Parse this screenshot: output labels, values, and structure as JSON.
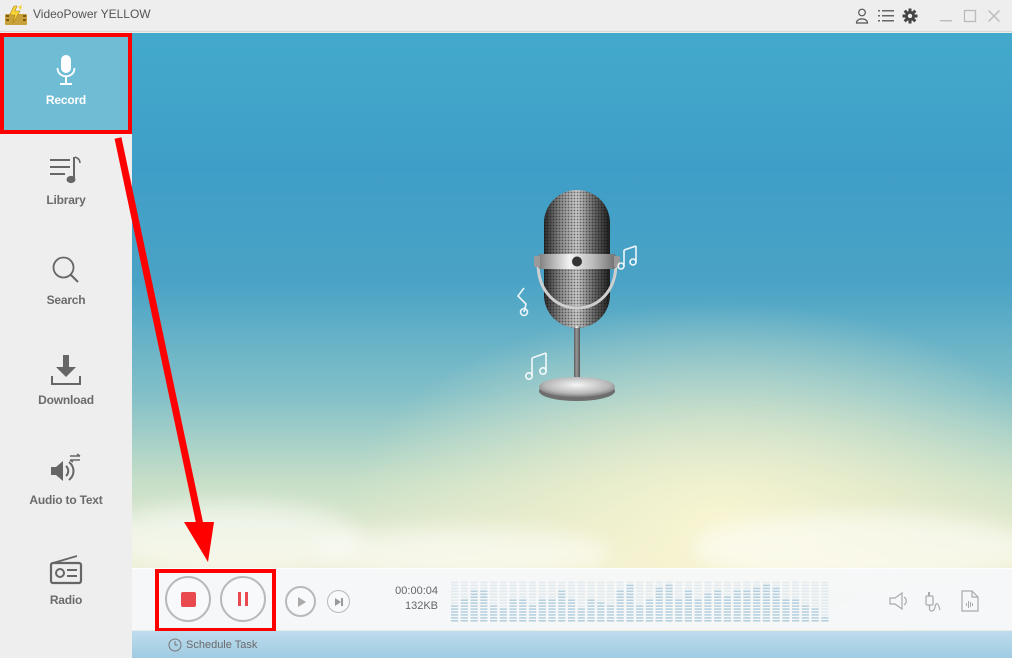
{
  "app": {
    "title": "VideoPower YELLOW"
  },
  "titlebar": {
    "icons": [
      "user-icon",
      "menu-list-icon",
      "settings-gear-icon",
      "minimize-icon",
      "maximize-icon",
      "close-icon"
    ]
  },
  "sidebar": {
    "items": [
      {
        "label": "Record",
        "icon": "microphone-icon",
        "active": true
      },
      {
        "label": "Library",
        "icon": "music-list-icon",
        "active": false
      },
      {
        "label": "Search",
        "icon": "search-icon",
        "active": false
      },
      {
        "label": "Download",
        "icon": "download-icon",
        "active": false
      },
      {
        "label": "Audio to Text",
        "icon": "speaker-convert-icon",
        "active": false
      },
      {
        "label": "Radio",
        "icon": "radio-icon",
        "active": false
      }
    ]
  },
  "player": {
    "elapsed": "00:00:04",
    "size": "132KB",
    "controls": [
      "stop",
      "pause",
      "play",
      "skip-next"
    ],
    "right_icons": [
      "system-sound-icon",
      "audio-input-icon",
      "audio-file-icon"
    ],
    "level_meter": [
      0.45,
      0.6,
      0.75,
      0.75,
      0.4,
      0.35,
      0.55,
      0.6,
      0.45,
      0.6,
      0.6,
      0.75,
      0.55,
      0.35,
      0.55,
      0.5,
      0.4,
      0.75,
      0.95,
      0.45,
      0.6,
      0.85,
      0.95,
      0.55,
      0.75,
      0.6,
      0.7,
      0.75,
      0.65,
      0.75,
      0.75,
      0.85,
      0.95,
      0.85,
      0.55,
      0.55,
      0.4,
      0.35,
      0.15
    ]
  },
  "footer": {
    "schedule_label": "Schedule Task"
  },
  "colors": {
    "sidebar_active": "#6fbcd5",
    "stop_red": "#e84a4f",
    "annotation_red": "#ff0000"
  }
}
